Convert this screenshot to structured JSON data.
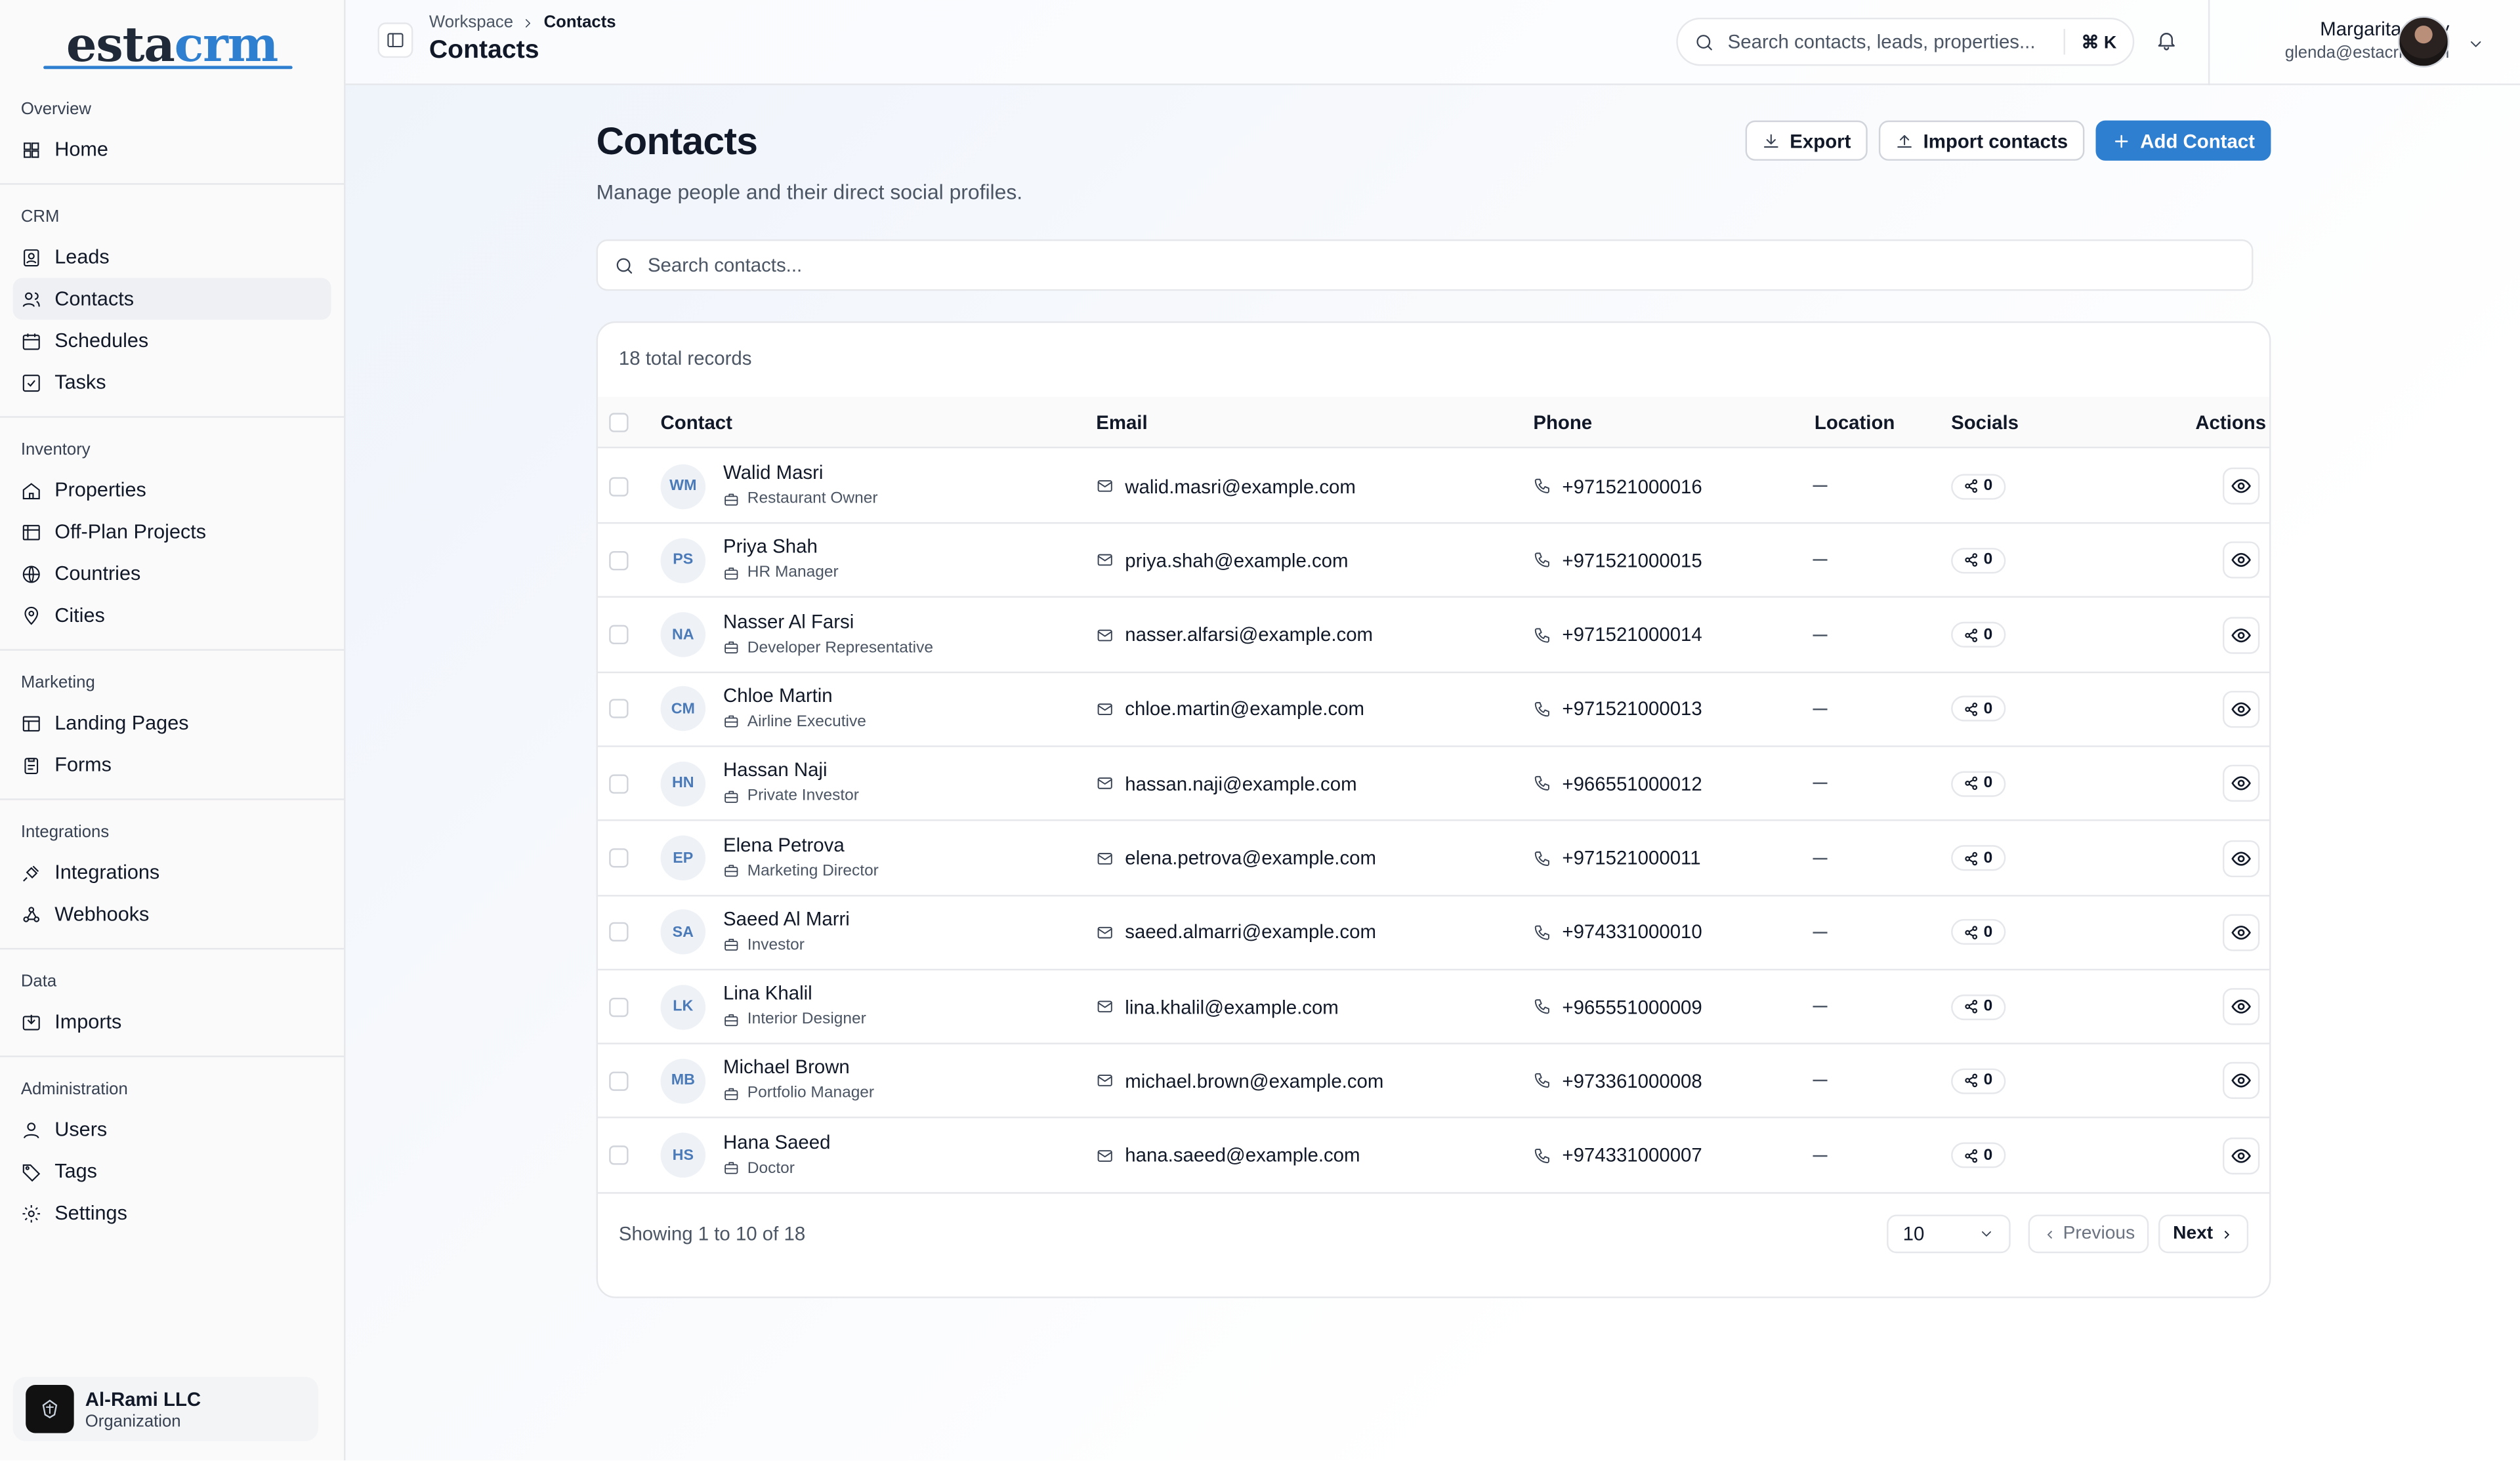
{
  "brand": {
    "logo_part1": "esta",
    "logo_part2": "crm"
  },
  "sidebar": {
    "sections": [
      {
        "title": "Overview",
        "items": [
          {
            "label": "Home",
            "icon": "grid-icon"
          }
        ]
      },
      {
        "title": "CRM",
        "items": [
          {
            "label": "Leads",
            "icon": "contact-card-icon"
          },
          {
            "label": "Contacts",
            "icon": "users-icon",
            "active": true
          },
          {
            "label": "Schedules",
            "icon": "calendar-icon"
          },
          {
            "label": "Tasks",
            "icon": "check-square-icon"
          }
        ]
      },
      {
        "title": "Inventory",
        "items": [
          {
            "label": "Properties",
            "icon": "house-icon"
          },
          {
            "label": "Off-Plan Projects",
            "icon": "building-icon"
          },
          {
            "label": "Countries",
            "icon": "globe-icon"
          },
          {
            "label": "Cities",
            "icon": "map-pin-icon"
          }
        ]
      },
      {
        "title": "Marketing",
        "items": [
          {
            "label": "Landing Pages",
            "icon": "layout-icon"
          },
          {
            "label": "Forms",
            "icon": "clipboard-icon"
          }
        ]
      },
      {
        "title": "Integrations",
        "items": [
          {
            "label": "Integrations",
            "icon": "plug-icon"
          },
          {
            "label": "Webhooks",
            "icon": "webhook-icon"
          }
        ]
      },
      {
        "title": "Data",
        "items": [
          {
            "label": "Imports",
            "icon": "import-icon"
          }
        ]
      },
      {
        "title": "Administration",
        "items": [
          {
            "label": "Users",
            "icon": "user-icon"
          },
          {
            "label": "Tags",
            "icon": "tag-icon"
          },
          {
            "label": "Settings",
            "icon": "gear-icon"
          }
        ]
      }
    ],
    "org": {
      "name": "Al-Rami LLC",
      "subtitle": "Organization"
    }
  },
  "topbar": {
    "breadcrumb": [
      "Workspace",
      "Contacts"
    ],
    "title": "Contacts",
    "search_placeholder": "Search contacts, leads, properties...",
    "shortcut": "⌘ K",
    "user": {
      "name": "Margarita Terry",
      "email": "glenda@estacrm.com"
    }
  },
  "page": {
    "title": "Contacts",
    "subtitle": "Manage people and their direct social profiles.",
    "export_label": "Export",
    "import_label": "Import contacts",
    "add_label": "Add Contact",
    "search_placeholder": "Search contacts..."
  },
  "table": {
    "total": "18 total records",
    "columns": {
      "contact": "Contact",
      "email": "Email",
      "phone": "Phone",
      "location": "Location",
      "socials": "Socials",
      "actions": "Actions"
    },
    "rows": [
      {
        "initials": "WM",
        "name": "Walid Masri",
        "role": "Restaurant Owner",
        "email": "walid.masri@example.com",
        "phone": "+971521000016",
        "location": "—",
        "socials": "0"
      },
      {
        "initials": "PS",
        "name": "Priya Shah",
        "role": "HR Manager",
        "email": "priya.shah@example.com",
        "phone": "+971521000015",
        "location": "—",
        "socials": "0"
      },
      {
        "initials": "NA",
        "name": "Nasser Al Farsi",
        "role": "Developer Representative",
        "email": "nasser.alfarsi@example.com",
        "phone": "+971521000014",
        "location": "—",
        "socials": "0"
      },
      {
        "initials": "CM",
        "name": "Chloe Martin",
        "role": "Airline Executive",
        "email": "chloe.martin@example.com",
        "phone": "+971521000013",
        "location": "—",
        "socials": "0"
      },
      {
        "initials": "HN",
        "name": "Hassan Naji",
        "role": "Private Investor",
        "email": "hassan.naji@example.com",
        "phone": "+966551000012",
        "location": "—",
        "socials": "0"
      },
      {
        "initials": "EP",
        "name": "Elena Petrova",
        "role": "Marketing Director",
        "email": "elena.petrova@example.com",
        "phone": "+971521000011",
        "location": "—",
        "socials": "0"
      },
      {
        "initials": "SA",
        "name": "Saeed Al Marri",
        "role": "Investor",
        "email": "saeed.almarri@example.com",
        "phone": "+974331000010",
        "location": "—",
        "socials": "0"
      },
      {
        "initials": "LK",
        "name": "Lina Khalil",
        "role": "Interior Designer",
        "email": "lina.khalil@example.com",
        "phone": "+965551000009",
        "location": "—",
        "socials": "0"
      },
      {
        "initials": "MB",
        "name": "Michael Brown",
        "role": "Portfolio Manager",
        "email": "michael.brown@example.com",
        "phone": "+973361000008",
        "location": "—",
        "socials": "0"
      },
      {
        "initials": "HS",
        "name": "Hana Saeed",
        "role": "Doctor",
        "email": "hana.saeed@example.com",
        "phone": "+974331000007",
        "location": "—",
        "socials": "0"
      }
    ],
    "showing": "Showing 1 to 10 of 18",
    "page_size": "10",
    "prev_label": "Previous",
    "next_label": "Next"
  },
  "colors": {
    "accent": "#2f7fd1",
    "avatar_bg": "#eef2f7",
    "avatar_text": "#4b7ab8"
  }
}
